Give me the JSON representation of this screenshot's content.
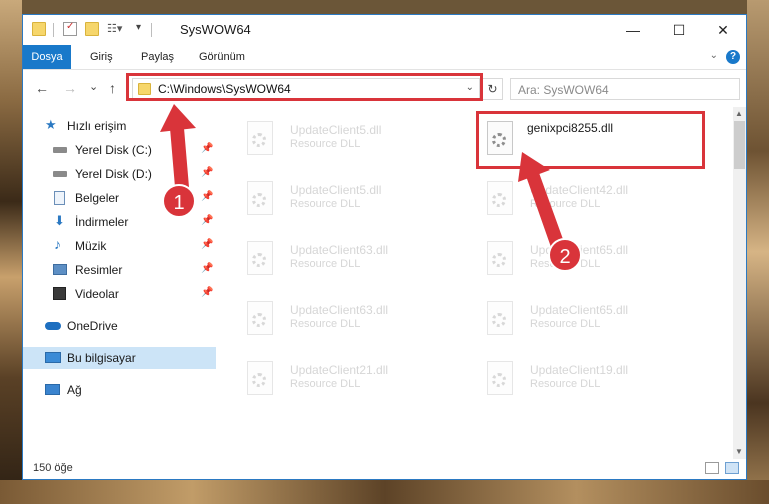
{
  "window": {
    "title": "SysWOW64",
    "controls": {
      "minimize": "—",
      "maximize": "☐",
      "close": "✕"
    }
  },
  "ribbon": {
    "tabs": [
      "Dosya",
      "Giriş",
      "Paylaş",
      "Görünüm"
    ],
    "help": "?"
  },
  "navigation": {
    "back": "←",
    "forward": "→",
    "recent": "⌄",
    "up": "↑",
    "address": "C:\\Windows\\SysWOW64",
    "refresh": "↻",
    "search_placeholder": "Ara: SysWOW64"
  },
  "sidebar": {
    "items": [
      {
        "label": "Hızlı erişim",
        "icon": "star-icon"
      },
      {
        "label": "Yerel Disk (C:)",
        "icon": "drive-icon"
      },
      {
        "label": "Yerel Disk (D:)",
        "icon": "drive-icon"
      },
      {
        "label": "Belgeler",
        "icon": "documents-icon"
      },
      {
        "label": "İndirmeler",
        "icon": "downloads-icon"
      },
      {
        "label": "Müzik",
        "icon": "music-icon"
      },
      {
        "label": "Resimler",
        "icon": "pictures-icon"
      },
      {
        "label": "Videolar",
        "icon": "videos-icon"
      },
      {
        "label": "OneDrive",
        "icon": "cloud-icon"
      },
      {
        "label": "Bu bilgisayar",
        "icon": "computer-icon"
      },
      {
        "label": "Ağ",
        "icon": "network-icon"
      }
    ]
  },
  "files": [
    {
      "name": "UpdateClient5.dll",
      "type": "Resource DLL"
    },
    {
      "name": "genixpci8255.dll",
      "type": ""
    },
    {
      "name": "UpdateClient5.dll",
      "type": "Resource DLL"
    },
    {
      "name": "UpdateClient42.dll",
      "type": "Resource DLL"
    },
    {
      "name": "UpdateClient63.dll",
      "type": "Resource DLL"
    },
    {
      "name": "UpdateClient65.dll",
      "type": "Resource DLL"
    },
    {
      "name": "UpdateClient63.dll",
      "type": "Resource DLL"
    },
    {
      "name": "UpdateClient65.dll",
      "type": "Resource DLL"
    },
    {
      "name": "UpdateClient21.dll",
      "type": "Resource DLL"
    },
    {
      "name": "UpdateClient19.dll",
      "type": "Resource DLL"
    }
  ],
  "status": {
    "count": "150 öğe"
  },
  "annotations": {
    "step1": "1",
    "step2": "2",
    "color": "#d9343a"
  },
  "colors": {
    "accent": "#1979ca",
    "highlight": "#d9343a",
    "selected": "#cce4f7"
  }
}
